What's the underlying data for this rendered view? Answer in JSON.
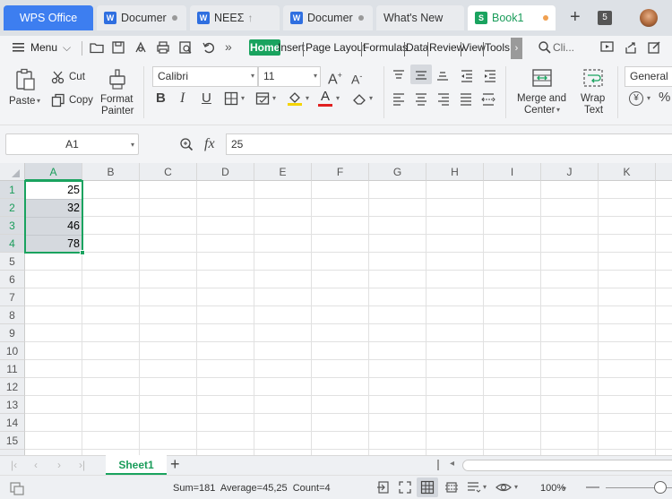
{
  "tabs": [
    {
      "label": "WPS Office"
    },
    {
      "label": "Documer"
    },
    {
      "label": "ΝΕΕΣ"
    },
    {
      "label": "Documer"
    },
    {
      "label": "What's New"
    },
    {
      "label": "Book1"
    }
  ],
  "tab_count": "5",
  "menu": {
    "menu_label": "Menu",
    "items": [
      "Home",
      "Insert",
      "Page Layout",
      "Formulas",
      "Data",
      "Review",
      "View",
      "Tools"
    ],
    "search_label": "Cli..."
  },
  "toolbar": {
    "paste": "Paste",
    "cut": "Cut",
    "copy": "Copy",
    "format_painter_1": "Format",
    "format_painter_2": "Painter",
    "font_name": "Calibri",
    "font_size": "11",
    "bold": "B",
    "italic": "I",
    "underline": "U",
    "merge_1": "Merge and",
    "merge_2": "Center",
    "wrap_1": "Wrap",
    "wrap_2": "Text",
    "number_format": "General"
  },
  "formula": {
    "name_box": "A1",
    "fx": "fx",
    "value": "25"
  },
  "columns": [
    "A",
    "B",
    "C",
    "D",
    "E",
    "F",
    "G",
    "H",
    "I",
    "J",
    "K"
  ],
  "rows": [
    "1",
    "2",
    "3",
    "4",
    "5",
    "6",
    "7",
    "8",
    "9",
    "10",
    "11",
    "12",
    "13",
    "14",
    "15"
  ],
  "cells": [
    "25",
    "32",
    "46",
    "78"
  ],
  "sheet": {
    "name": "Sheet1",
    "add": "+"
  },
  "status": {
    "summary": "Sum=181  Average=45,25  Count=4",
    "zoom": "100%"
  },
  "colors": {
    "accent": "#1aa35f",
    "wps_blue": "#3d7ef0"
  }
}
